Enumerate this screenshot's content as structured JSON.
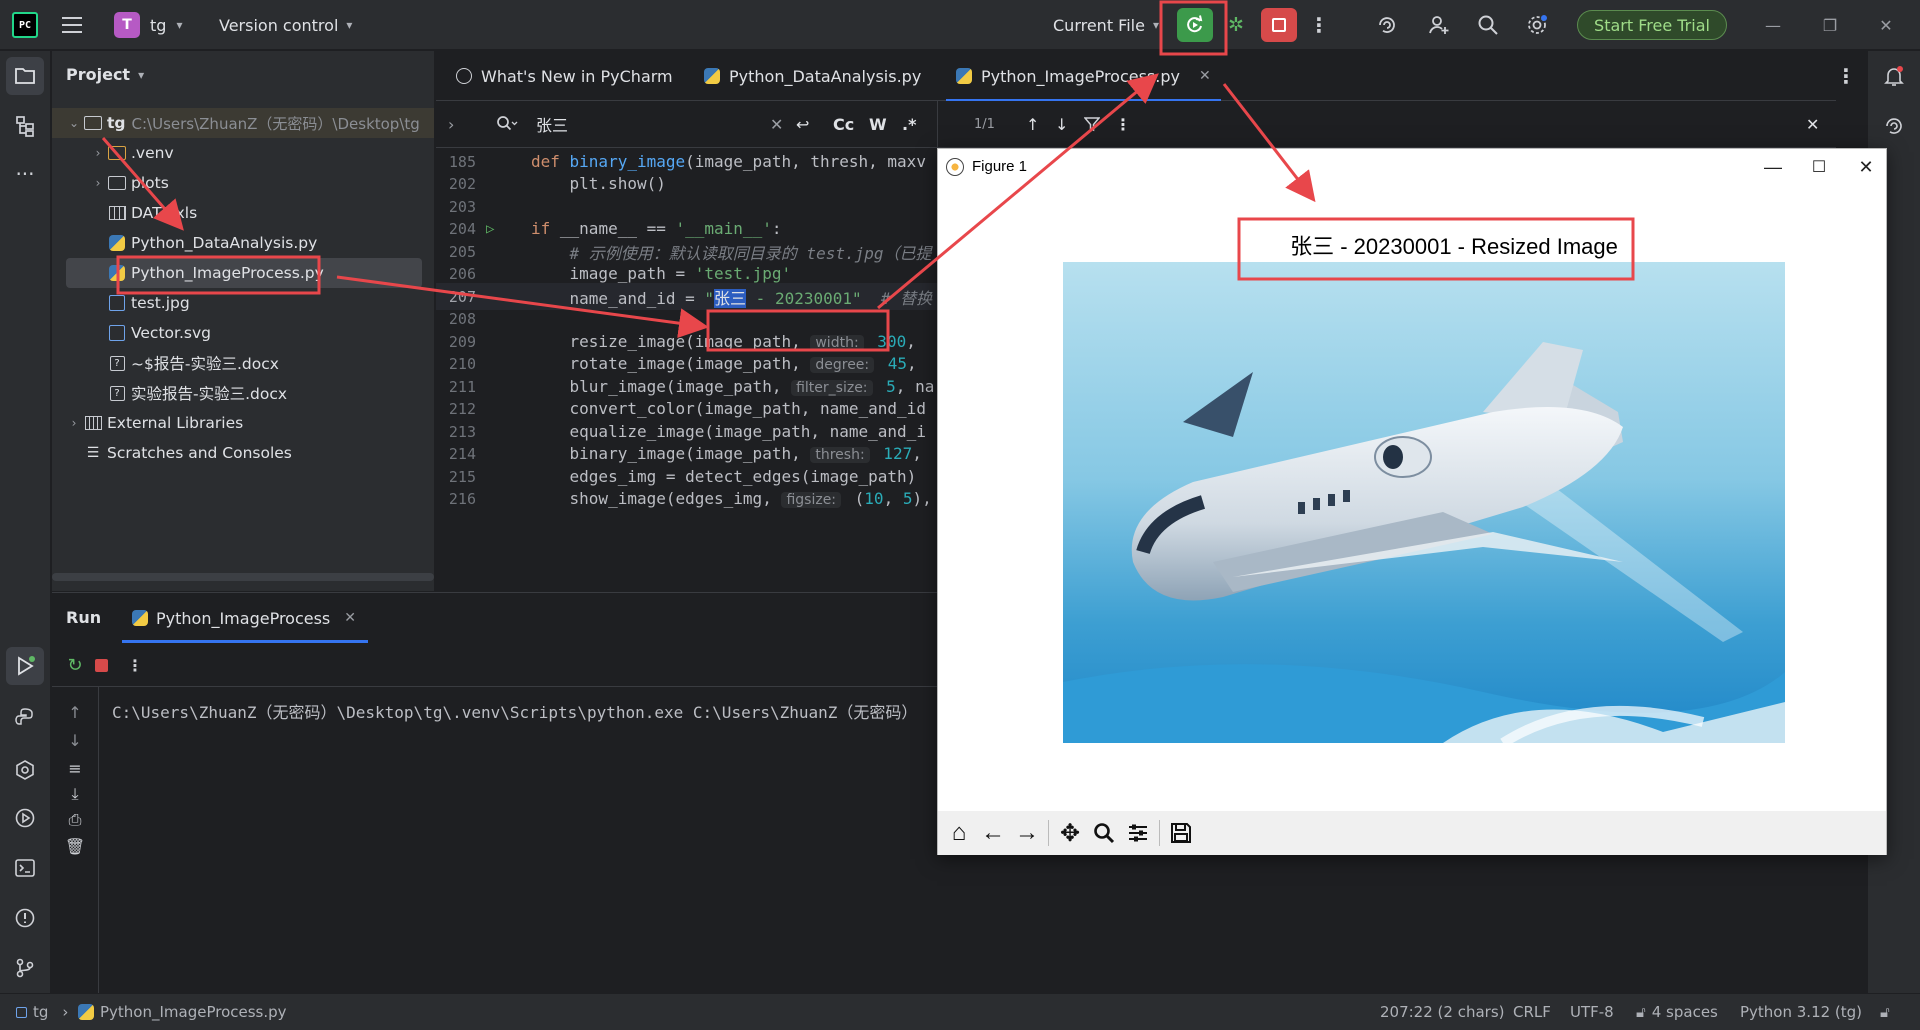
{
  "app": {
    "logo_text": "PC",
    "project_initial": "T",
    "project_name": "tg",
    "vcs_label": "Version control",
    "run_config": "Current File",
    "trial_button": "Start Free Trial"
  },
  "project_panel": {
    "title": "Project",
    "root_name": "tg",
    "root_path": "C:\\Users\\ZhuanZ（无密码）\\Desktop\\tg",
    "items": [
      {
        "label": ".venv",
        "type": "folder"
      },
      {
        "label": "plots",
        "type": "folder"
      },
      {
        "label": "DATA.xls",
        "type": "xls"
      },
      {
        "label": "Python_DataAnalysis.py",
        "type": "py"
      },
      {
        "label": "Python_ImageProcess.py",
        "type": "py"
      },
      {
        "label": "test.jpg",
        "type": "image"
      },
      {
        "label": "Vector.svg",
        "type": "image"
      },
      {
        "label": "~$报告-实验三.docx",
        "type": "doc"
      },
      {
        "label": "实验报告-实验三.docx",
        "type": "doc"
      }
    ],
    "external_libraries": "External Libraries",
    "scratches": "Scratches and Consoles"
  },
  "tabs": [
    {
      "label": "What's New in PyCharm"
    },
    {
      "label": "Python_DataAnalysis.py"
    },
    {
      "label": "Python_ImageProcess.py"
    }
  ],
  "find": {
    "query": "张三",
    "opt_case": "Cc",
    "opt_word": "W",
    "opt_regex": ".*",
    "match_count": "1/1"
  },
  "code": [
    {
      "ln": "185"
    },
    {
      "ln": "202"
    },
    {
      "ln": "203"
    },
    {
      "ln": "204"
    },
    {
      "ln": "205"
    },
    {
      "ln": "206"
    },
    {
      "ln": "207"
    },
    {
      "ln": "208"
    },
    {
      "ln": "209"
    },
    {
      "ln": "210"
    },
    {
      "ln": "211"
    },
    {
      "ln": "212"
    },
    {
      "ln": "213"
    },
    {
      "ln": "214"
    },
    {
      "ln": "215"
    },
    {
      "ln": "216"
    }
  ],
  "code_text": {
    "l185_def": "def ",
    "l185_fn": "binary_image",
    "l185_rest": "(image_path, thresh, maxv",
    "l202": "    plt.show()",
    "l204_if": "if ",
    "l204_rest": "__name__ == ",
    "l204_str": "'__main__'",
    "l204_colon": ":",
    "l205": "    # 示例使用：默认读取同目录的 test.jpg（已提",
    "l206_a": "    image_path = ",
    "l206_str": "'test.jpg'",
    "l207_a": "    name_and_id = ",
    "l207_q": "\"",
    "l207_hl": "张三",
    "l207_rest": " - 20230001\"",
    "l207_cm": "  # 替换",
    "l209_a": "    resize_image(image_path, ",
    "l209_hint": "width:",
    "l209_num": " 300",
    "l209_b": ",",
    "l210_a": "    rotate_image(image_path, ",
    "l210_hint": "degree:",
    "l210_num": " 45",
    "l210_b": ",",
    "l211_a": "    blur_image(image_path, ",
    "l211_hint": "filter_size:",
    "l211_num": " 5",
    "l211_b": ", na",
    "l212": "    convert_color(image_path, name_and_id",
    "l213": "    equalize_image(image_path, name_and_i",
    "l214_a": "    binary_image(image_path, ",
    "l214_hint": "thresh:",
    "l214_num": " 127",
    "l214_b": ",",
    "l215": "    edges_img = detect_edges(image_path)",
    "l216_a": "    show_image(edges_img, ",
    "l216_hint": "figsize:",
    "l216_b": " (",
    "l216_n1": "10",
    "l216_c": ", ",
    "l216_n2": "5",
    "l216_d": "),"
  },
  "run_panel": {
    "title": "Run",
    "tab_label": "Python_ImageProcess",
    "console_line": "C:\\Users\\ZhuanZ（无密码）\\Desktop\\tg\\.venv\\Scripts\\python.exe C:\\Users\\ZhuanZ（无密码）"
  },
  "figure": {
    "window_title": "Figure 1",
    "plot_title": "张三 - 20230001 - Resized Image"
  },
  "status_bar": {
    "project": "tg",
    "file": "Python_ImageProcess.py",
    "position": "207:22 (2 chars)",
    "line_sep": "CRLF",
    "encoding": "UTF-8",
    "indent": "4 spaces",
    "interpreter": "Python 3.12 (tg)"
  },
  "colors": {
    "annotation": "#e8474b",
    "accent": "#3574f0",
    "run_green": "#3c9a4b",
    "stop_red": "#d64a4a"
  }
}
